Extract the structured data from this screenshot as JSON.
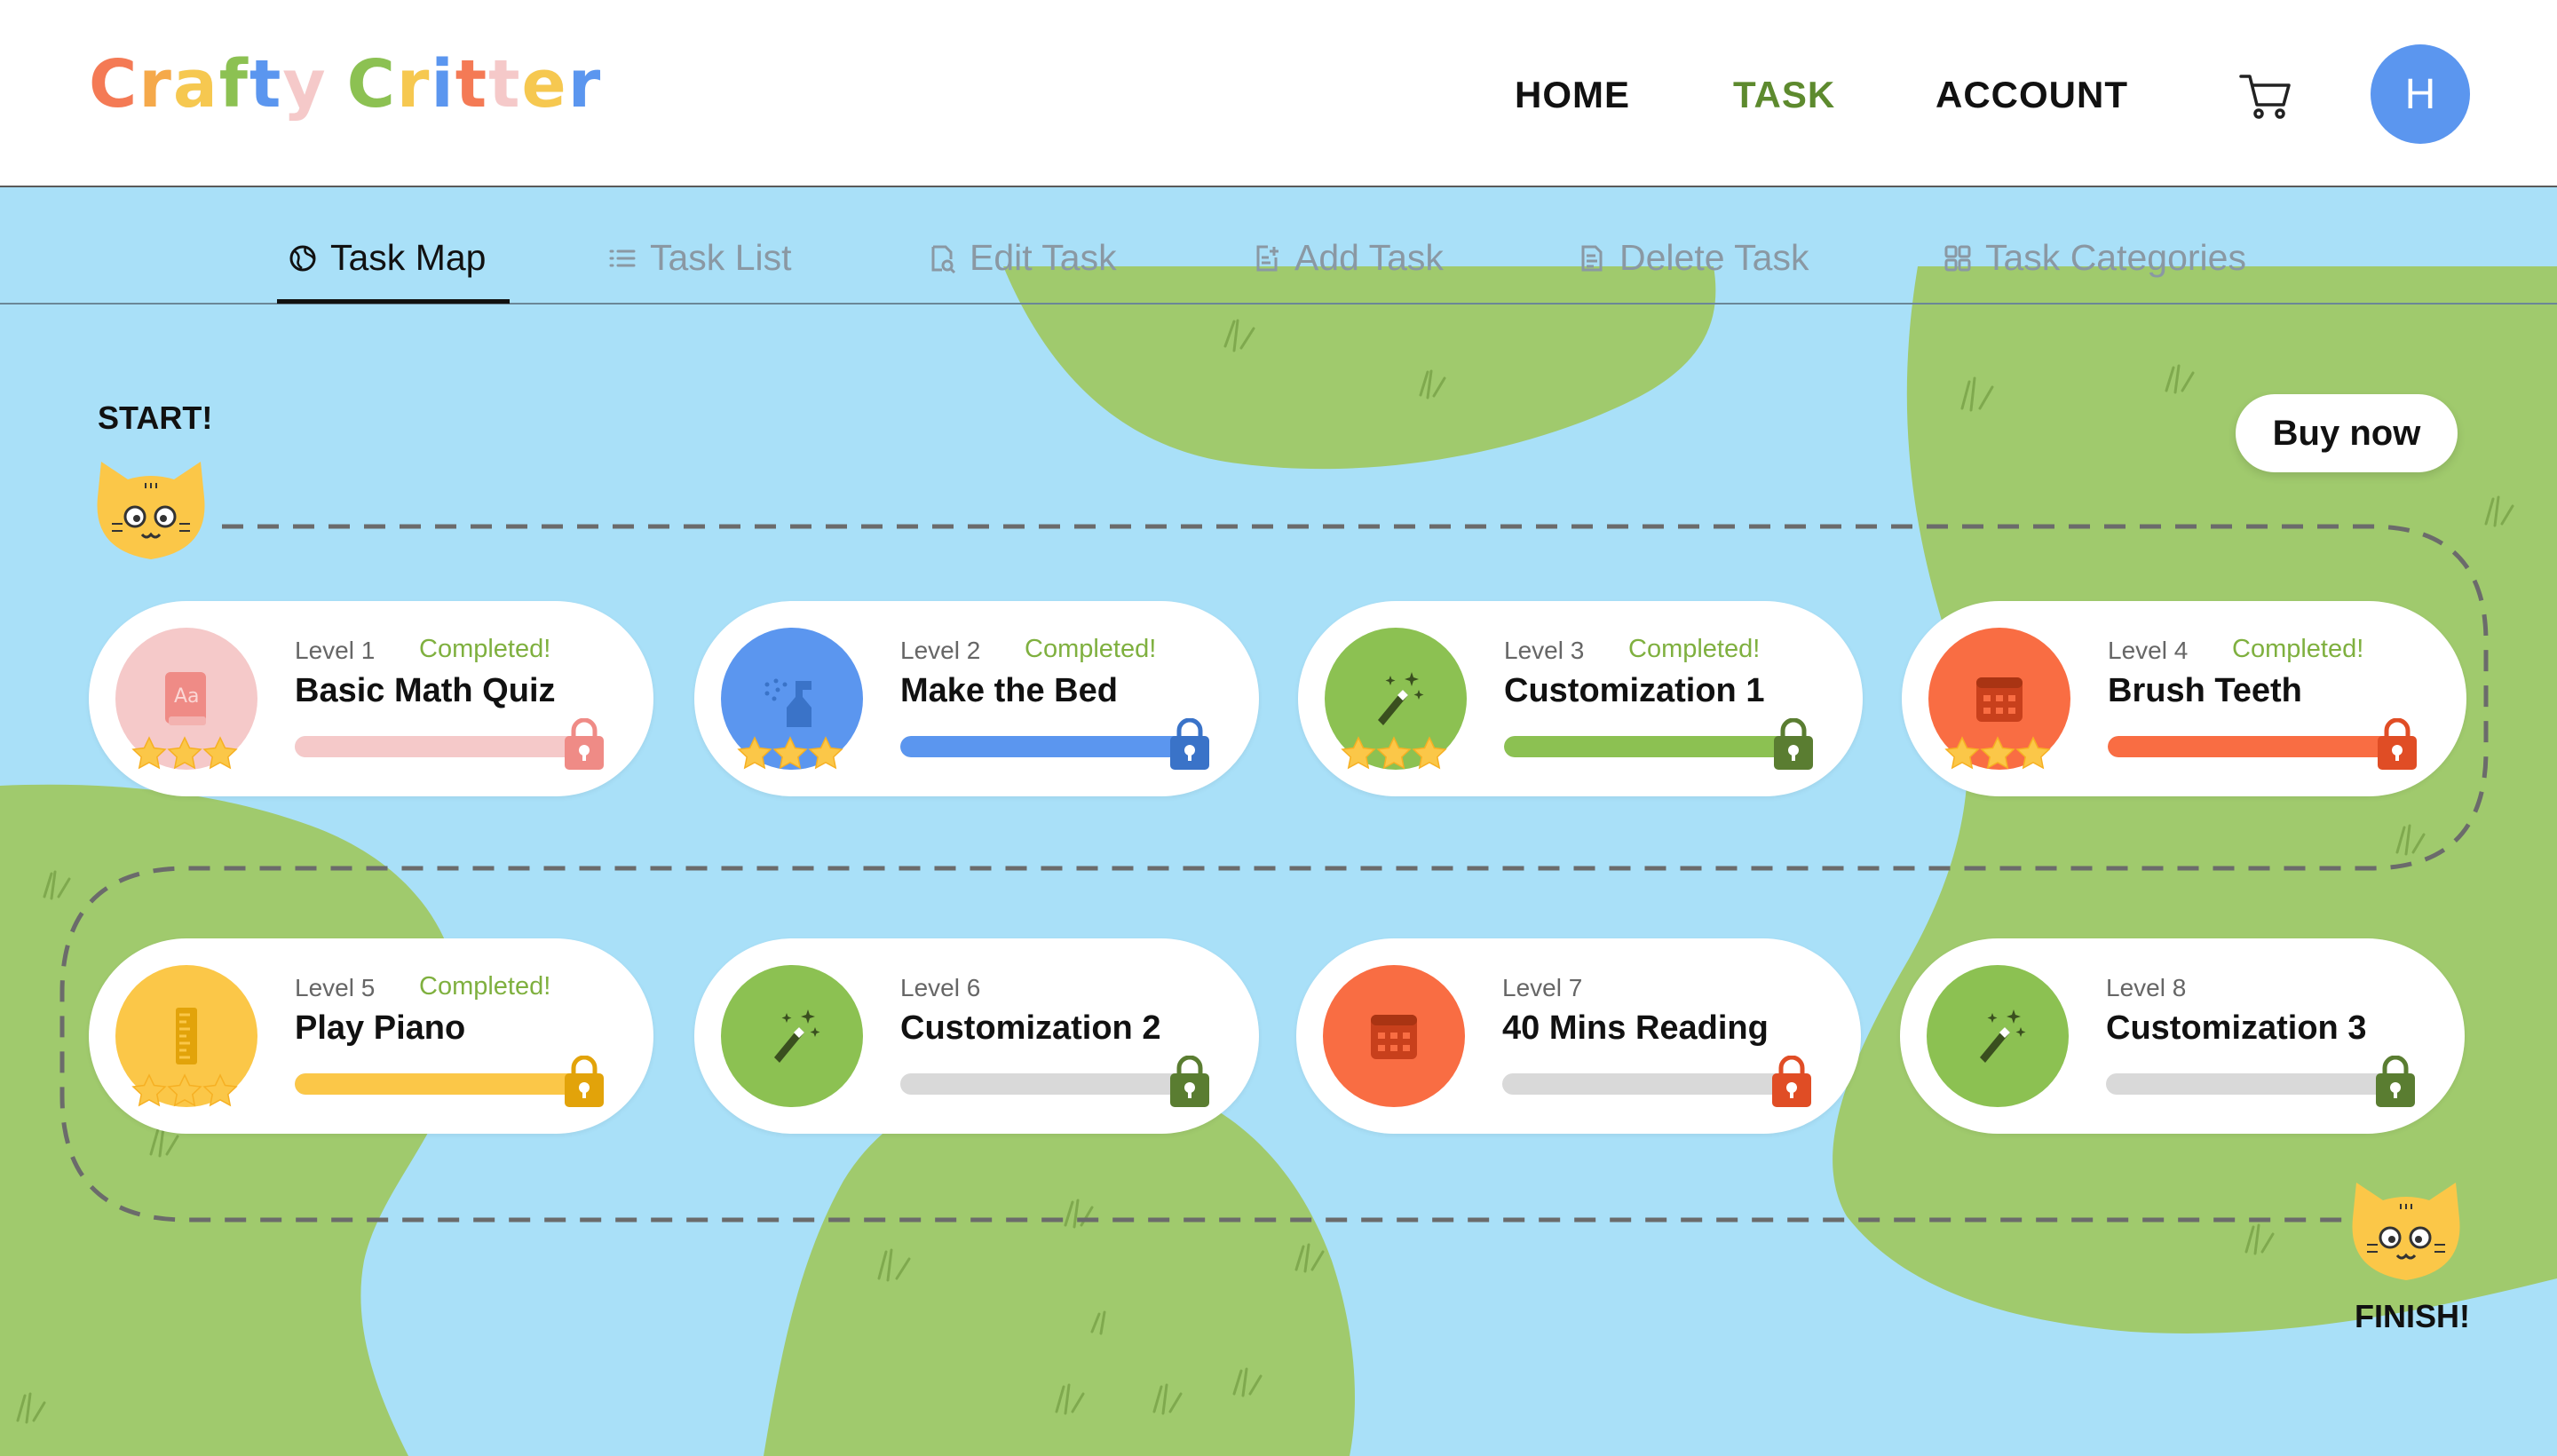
{
  "app": {
    "logo_letters": [
      {
        "ch": "C",
        "color": "#f47a55"
      },
      {
        "ch": "r",
        "color": "#f5a94a"
      },
      {
        "ch": "a",
        "color": "#f6c850"
      },
      {
        "ch": "f",
        "color": "#8cc152"
      },
      {
        "ch": "t",
        "color": "#5b96ef"
      },
      {
        "ch": "y",
        "color": "#f5c9c9"
      },
      {
        "ch": " ",
        "color": "#ffffff"
      },
      {
        "ch": "C",
        "color": "#8cc152"
      },
      {
        "ch": "r",
        "color": "#f6c850"
      },
      {
        "ch": "i",
        "color": "#5b96ef"
      },
      {
        "ch": "t",
        "color": "#f47a55"
      },
      {
        "ch": "t",
        "color": "#f5c9c9"
      },
      {
        "ch": "e",
        "color": "#f6c850"
      },
      {
        "ch": "r",
        "color": "#5b96ef"
      }
    ]
  },
  "nav": {
    "home": "HOME",
    "task": "TASK",
    "account": "ACCOUNT",
    "avatar_initial": "H",
    "cart_icon": "cart-icon"
  },
  "tabs": [
    {
      "label": "Task Map",
      "icon": "globe-icon",
      "active": true
    },
    {
      "label": "Task List",
      "icon": "list-icon",
      "active": false
    },
    {
      "label": "Edit Task",
      "icon": "edit-document-icon",
      "active": false
    },
    {
      "label": "Add Task",
      "icon": "add-document-icon",
      "active": false
    },
    {
      "label": "Delete Task",
      "icon": "delete-document-icon",
      "active": false
    },
    {
      "label": "Task Categories",
      "icon": "grid-icon",
      "active": false
    }
  ],
  "map": {
    "start_label": "START!",
    "finish_label": "FINISH!",
    "buy_button": "Buy now"
  },
  "colors": {
    "water": "#a9e0f8",
    "land": "#a0ca6d",
    "pink": "#f5c9c9",
    "pink_dark": "#ef8b86",
    "blue": "#5b96ef",
    "blue_dark": "#3a73c8",
    "green": "#8cc152",
    "green_dark": "#5a7d31",
    "orange": "#f96d43",
    "orange_dark": "#e04d25",
    "yellow": "#fbc748",
    "yellow_dark": "#e2a30a",
    "gray_track": "#d9d9d9"
  },
  "cards": [
    {
      "level": "Level 1",
      "status": "Completed!",
      "title": "Basic Math Quiz",
      "icon": "dictionary-icon",
      "color": "#f5c9c9",
      "icon_color": "#ef8b86",
      "lock_color": "#ef8b86",
      "progress": 1.0,
      "stars": 3
    },
    {
      "level": "Level 2",
      "status": "Completed!",
      "title": "Make the Bed",
      "icon": "spray-bottle-icon",
      "color": "#5b96ef",
      "icon_color": "#3a73c8",
      "lock_color": "#3a73c8",
      "progress": 1.0,
      "stars": 3
    },
    {
      "level": "Level 3",
      "status": "Completed!",
      "title": "Customization 1",
      "icon": "magic-wand-icon",
      "color": "#8cc152",
      "icon_color": "#3a4f1f",
      "lock_color": "#5a7d31",
      "progress": 1.0,
      "stars": 3
    },
    {
      "level": "Level 4",
      "status": "Completed!",
      "title": "Brush Teeth",
      "icon": "calendar-icon",
      "color": "#f96d43",
      "icon_color": "#c8401c",
      "lock_color": "#e04d25",
      "progress": 1.0,
      "stars": 3
    },
    {
      "level": "Level 5",
      "status": "Completed!",
      "title": "Play Piano",
      "icon": "ruler-icon",
      "color": "#fbc748",
      "icon_color": "#e2a30a",
      "lock_color": "#e2a30a",
      "progress": 1.0,
      "stars": 3
    },
    {
      "level": "Level 6",
      "status": "",
      "title": "Customization 2",
      "icon": "magic-wand-icon",
      "color": "#8cc152",
      "icon_color": "#3a4f1f",
      "lock_color": "#5a7d31",
      "progress": 0.0,
      "stars": 0
    },
    {
      "level": "Level 7",
      "status": "",
      "title": "40 Mins Reading",
      "icon": "calendar-icon",
      "color": "#f96d43",
      "icon_color": "#c8401c",
      "lock_color": "#e04d25",
      "progress": 0.0,
      "stars": 0
    },
    {
      "level": "Level 8",
      "status": "",
      "title": "Customization 3",
      "icon": "magic-wand-icon",
      "color": "#8cc152",
      "icon_color": "#3a4f1f",
      "lock_color": "#5a7d31",
      "progress": 0.0,
      "stars": 0
    }
  ]
}
